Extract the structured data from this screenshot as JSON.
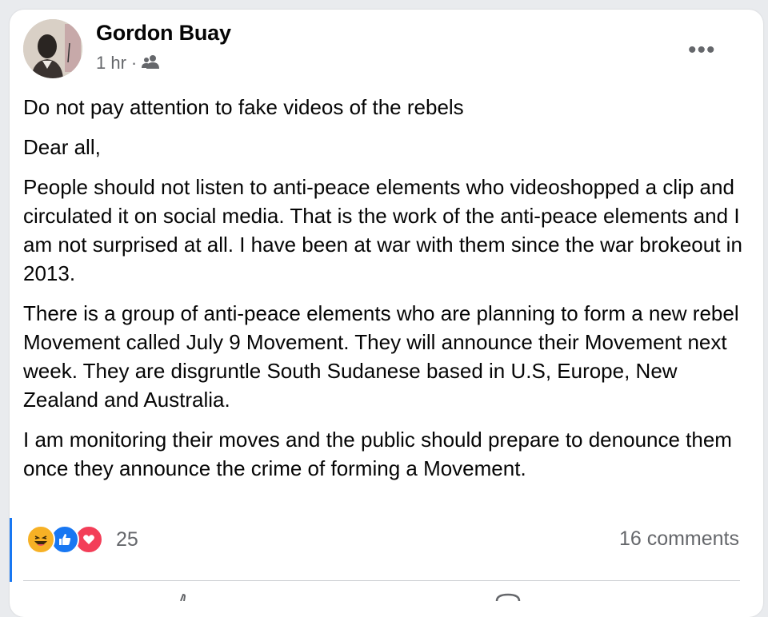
{
  "post": {
    "author": "Gordon Buay",
    "time": "1 hr",
    "separator": "·",
    "audience_icon": "friends-icon",
    "paragraphs": [
      "Do not pay attention to fake videos of the rebels",
      "Dear all,",
      "People should not listen to anti-peace elements who videoshopped a clip and circulated it on social media. That is the work of the anti-peace elements and I am not surprised at all. I have been at war with them since the war brokeout in 2013.",
      "There is a group of anti-peace elements who are planning to form a new rebel Movement called July 9 Movement. They will announce their Movement next week. They are disgruntle South Sudanese based in U.S, Europe, New Zealand and Australia.",
      "I am monitoring their moves and the public should prepare to denounce them once they announce the crime of forming a Movement."
    ]
  },
  "footer": {
    "reaction_icons": [
      "haha-icon",
      "like-icon",
      "love-icon"
    ],
    "reaction_count": "25",
    "comments": "16 comments"
  },
  "colors": {
    "like": "#1877f2",
    "love": "#f33e58",
    "haha": "#f7b125",
    "muted": "#65676b"
  }
}
